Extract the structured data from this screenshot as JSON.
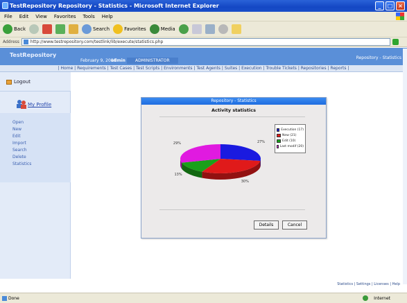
{
  "window": {
    "title": "TestRepository Repository - Statistics - Microsoft Internet Explorer",
    "controls": [
      "_",
      "□",
      "×"
    ]
  },
  "menu": [
    "File",
    "Edit",
    "View",
    "Favorites",
    "Tools",
    "Help"
  ],
  "toolbar": {
    "back": "Back",
    "search": "Search",
    "favorites": "Favorites",
    "media": "Media"
  },
  "address": {
    "label": "Address",
    "url": "http://www.testrepository.com/testlink/lib/execute/statistics.php"
  },
  "app": {
    "brand": "TestRepository",
    "date": "February 9, 2006",
    "user": "admin",
    "role": "ADMINISTRATOR",
    "right_links": "Repository - Statistics",
    "nav": "| Home | Requirements | Test Cases | Test Scripts | Environments | Test Agents | Suites | Execution | Trouble Tickets | Repositories | Reports |"
  },
  "sidebar": {
    "logout": "Logout",
    "profile": "My Profile",
    "menu": [
      "Open",
      "New",
      "Edit",
      "Import",
      "Search",
      "Delete",
      "Statistics"
    ]
  },
  "dialog": {
    "title": "Repository - Statistics",
    "heading": "Activity statistics",
    "details_button": "Details",
    "cancel_button": "Cancel"
  },
  "chart_data": {
    "type": "pie",
    "title": "Activity statistics",
    "legend_position": "top-right",
    "slices": [
      {
        "label": "Execution (17)",
        "value": 27,
        "pct_label": "27%",
        "color": "#1a1ae0"
      },
      {
        "label": "New (21)",
        "value": 30,
        "pct_label": "30%",
        "color": "#e01a1a"
      },
      {
        "label": "Edit (10)",
        "value": 13,
        "pct_label": "13%",
        "color": "#1aa01a"
      },
      {
        "label": "Last modif (20)",
        "value": 29,
        "pct_label": "29%",
        "color": "#e01ae0"
      }
    ]
  },
  "footer_links": "Statistics | Settings | Licenses | Help",
  "status": {
    "left": "Done",
    "zone": "Internet"
  }
}
